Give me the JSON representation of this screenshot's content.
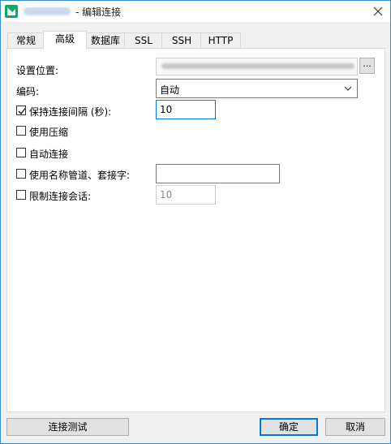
{
  "window": {
    "title": "- 编辑连接",
    "close_icon": "close-icon"
  },
  "tabs": [
    {
      "label": "常规"
    },
    {
      "label": "高级"
    },
    {
      "label": "数据库"
    },
    {
      "label": "SSL"
    },
    {
      "label": "SSH"
    },
    {
      "label": "HTTP"
    }
  ],
  "active_tab": "高级",
  "form": {
    "location_label": "设置位置:",
    "encoding_label": "编码:",
    "encoding_value": "自动",
    "keepalive_label": "保持连接间隔 (秒):",
    "keepalive_checked": true,
    "keepalive_value": "10",
    "compress_label": "使用压缩",
    "compress_checked": false,
    "autoconnect_label": "自动连接",
    "autoconnect_checked": false,
    "namedpipe_label": "使用名称管道、套接字:",
    "namedpipe_checked": false,
    "namedpipe_value": "",
    "limit_label": "限制连接会话:",
    "limit_checked": false,
    "limit_value": "10",
    "browse_label": "..."
  },
  "buttons": {
    "test": "连接测试",
    "ok": "确定",
    "cancel": "取消"
  },
  "colors": {
    "accent": "#0078d7",
    "app_icon": "#1aa36a"
  }
}
